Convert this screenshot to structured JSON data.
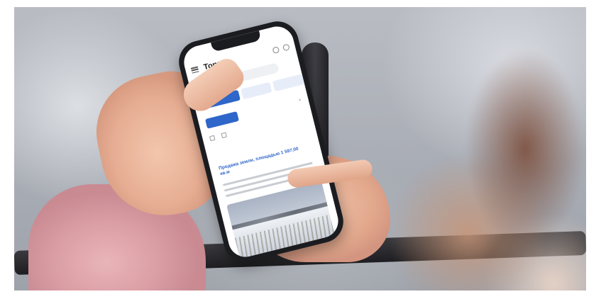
{
  "app": {
    "title": "Торги"
  },
  "listing": {
    "title": "Продажа земли, площадью 1 597,00 кв.м"
  },
  "colors": {
    "accent": "#2f66c9",
    "sleeve": "#e9b5b8",
    "skin": "#efbfa5"
  },
  "icons": [
    "menu-icon",
    "search-icon",
    "user-icon"
  ]
}
